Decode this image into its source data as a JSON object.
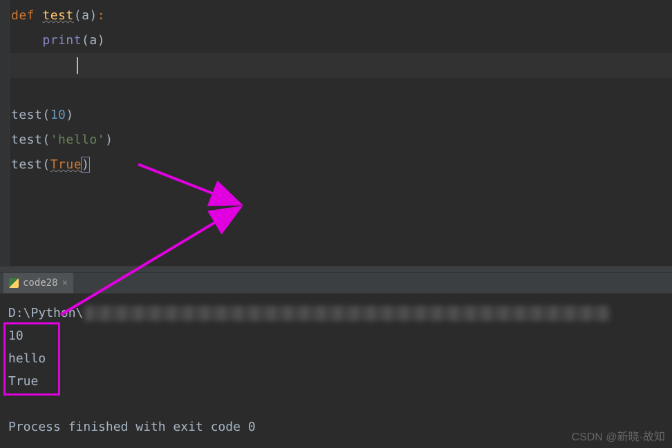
{
  "code": {
    "line1": {
      "def": "def",
      "fn": "test",
      "open": "(",
      "param": "a",
      "close": ")",
      "colon": ":"
    },
    "line2": {
      "indent": "    ",
      "builtin": "print",
      "open": "(",
      "param": "a",
      "close": ")"
    },
    "line5": {
      "fn": "test",
      "open": "(",
      "arg": "10",
      "close": ")"
    },
    "line6": {
      "fn": "test",
      "open": "(",
      "arg": "'hello'",
      "close": ")"
    },
    "line7": {
      "fn": "test",
      "open": "(",
      "arg": "True",
      "close": ")"
    }
  },
  "tab": {
    "name": "code28",
    "close": "×"
  },
  "console": {
    "path": "D:\\Python\\",
    "out1": "10",
    "out2": "hello",
    "out3": "True",
    "exit": "Process finished with exit code 0"
  },
  "watermark": "CSDN @新晓·故知"
}
